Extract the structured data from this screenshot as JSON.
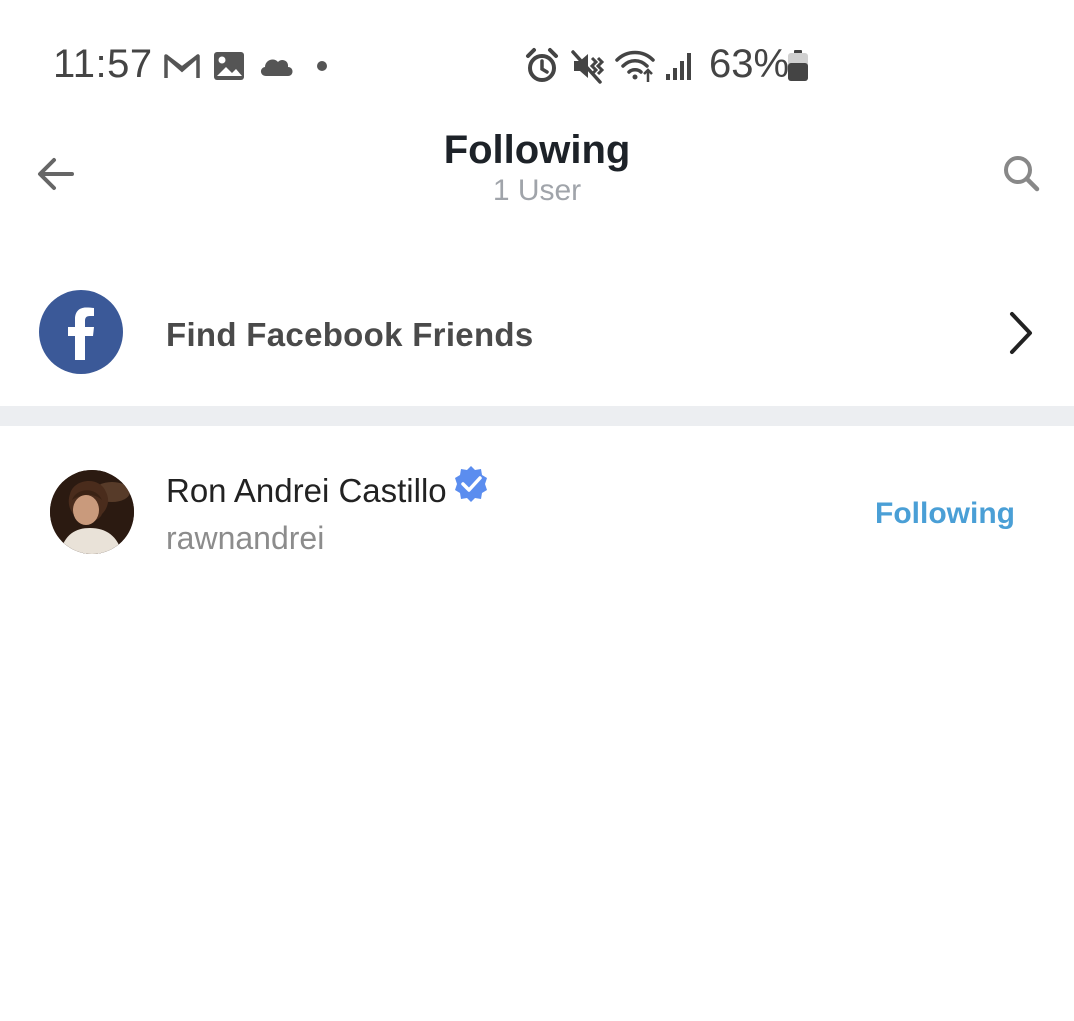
{
  "status_bar": {
    "time": "11:57",
    "battery_percent": "63%",
    "left_icons": [
      "gmail-icon",
      "gallery-icon",
      "cloud-icon",
      "dot-icon"
    ],
    "right_icons": [
      "alarm-icon",
      "mute-icon",
      "wifi-icon",
      "signal-icon",
      "battery-icon"
    ]
  },
  "header": {
    "title": "Following",
    "subtitle": "1 User"
  },
  "facebook_row": {
    "label": "Find Facebook Friends",
    "brand_color": "#3b5998"
  },
  "users": [
    {
      "name": "Ron Andrei Castillo",
      "handle": "rawnandrei",
      "verified": true,
      "action_label": "Following"
    }
  ],
  "colors": {
    "accent": "#4a9fd6",
    "verified_badge": "#5b8def",
    "divider": "#eceef1"
  }
}
